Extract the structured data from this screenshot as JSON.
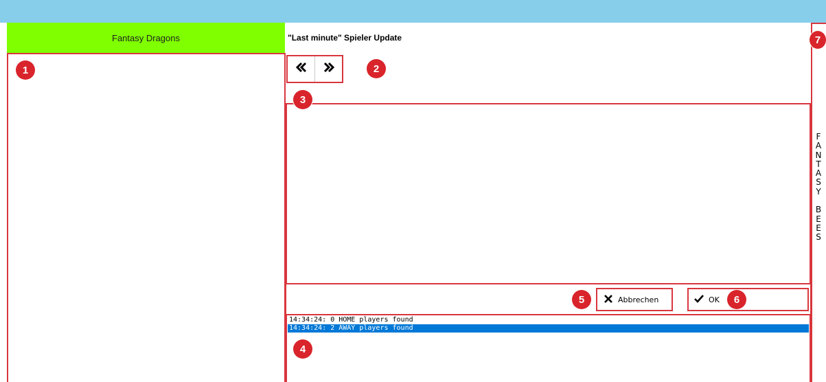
{
  "home_team": {
    "name": "Fantasy Dragons"
  },
  "dialog": {
    "title": "\"Last minute\" Spieler Update"
  },
  "navigation": {
    "prev_icon": "double-chevron-left",
    "next_icon": "double-chevron-right"
  },
  "buttons": {
    "cancel": {
      "label": "Abbrechen",
      "icon": "close-icon"
    },
    "ok": {
      "label": "OK",
      "icon": "checkmark-icon"
    }
  },
  "log": {
    "lines": [
      {
        "text": "14:34:24: 0 HOME players found",
        "selected": false
      },
      {
        "text": "14:34:24: 2 AWAY players found",
        "selected": true
      }
    ]
  },
  "away_team": {
    "name": "FANTASY BEES"
  },
  "markers": [
    "1",
    "2",
    "3",
    "4",
    "5",
    "6",
    "7"
  ],
  "colors": {
    "topbar": "#87ceeb",
    "home_header": "#7fff00",
    "annotation": "#d9363e",
    "selection": "#0078d7"
  }
}
